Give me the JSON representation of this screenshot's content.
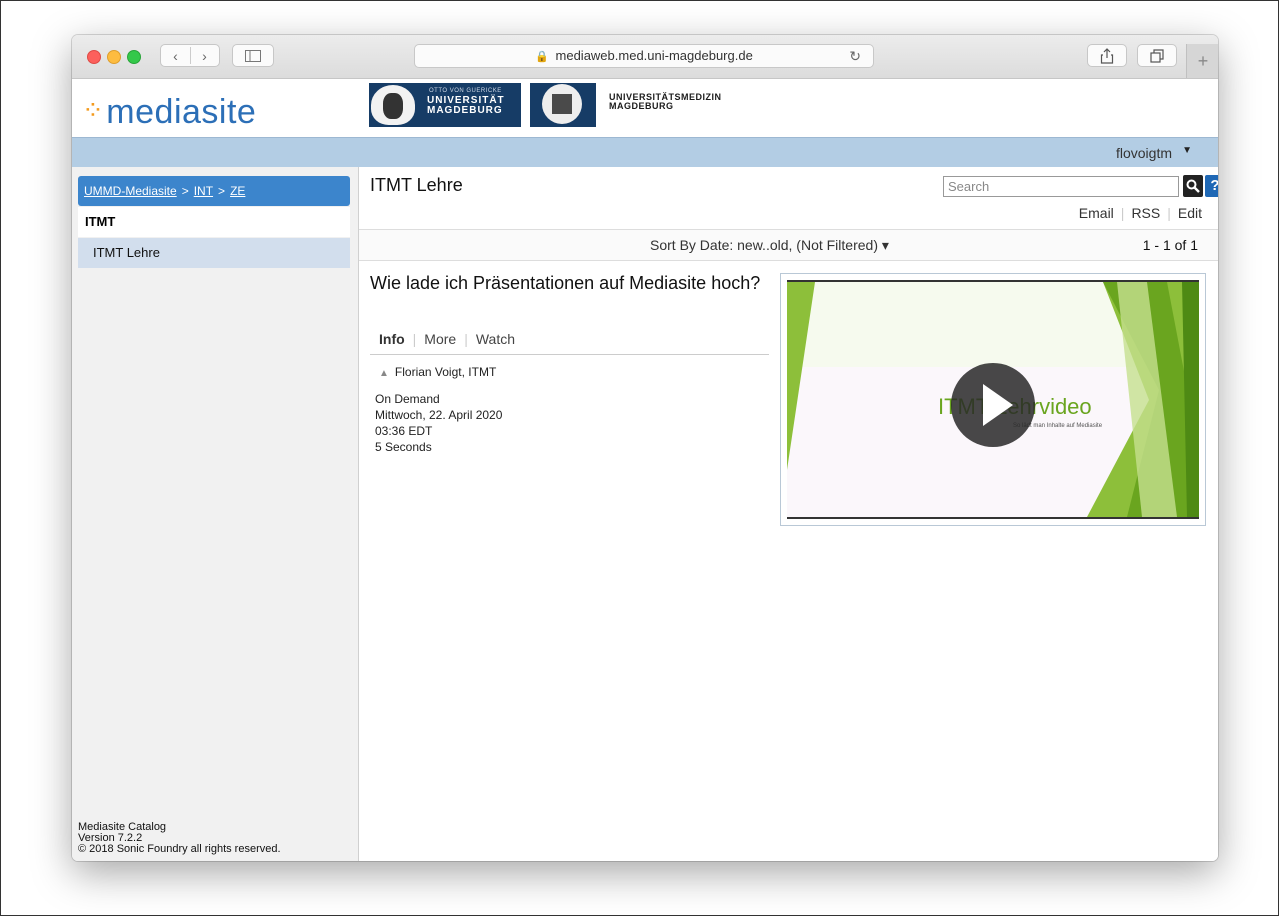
{
  "browser": {
    "url": "mediaweb.med.uni-magdeburg.de",
    "new_tab_label": "+"
  },
  "header": {
    "logo_text": "mediasite",
    "uni_logo_small": "OTTO VON GUERICKE",
    "uni_logo_line1": "UNIVERSITÄT",
    "uni_logo_line2": "MAGDEBURG",
    "med_logo_line1": "UNIVERSITÄTSMEDIZIN",
    "med_logo_line2": "MAGDEBURG"
  },
  "userbar": {
    "username": "flovoigtm"
  },
  "sidebar": {
    "breadcrumb": [
      "UMMD-Mediasite",
      "INT",
      "ZE"
    ],
    "folder_title": "ITMT",
    "items": [
      {
        "label": "ITMT Lehre"
      }
    ],
    "footer": {
      "line1": "Mediasite Catalog",
      "line2": "Version 7.2.2",
      "line3": "© 2018 Sonic Foundry all rights reserved."
    }
  },
  "main": {
    "title": "ITMT Lehre",
    "search_placeholder": "Search",
    "help_label": "?",
    "actions": [
      "Email",
      "RSS",
      "Edit"
    ],
    "sort_text": "Sort By Date: new..old, (Not Filtered) ▾",
    "page_count": "1 - 1 of 1",
    "presentation": {
      "title": "Wie lade ich Präsentationen auf Mediasite hoch?",
      "tabs": [
        "Info",
        "More",
        "Watch"
      ],
      "presenter": "Florian Voigt, ITMT",
      "availability": "On Demand",
      "date": "Mittwoch, 22. April 2020",
      "time": "03:36 EDT",
      "duration": "5 Seconds",
      "thumbnail_title": "ITMT Lehrvideo",
      "thumbnail_subtitle": "So lädt man Inhalte auf Mediasite"
    }
  },
  "colors": {
    "accent_blue": "#3c85cc",
    "userbar": "#b3cde4",
    "selected_item": "#d2deed",
    "logo_blue": "#2c6fb7",
    "logo_orange": "#f39a1e",
    "thumb_green": "#6aa51f"
  }
}
